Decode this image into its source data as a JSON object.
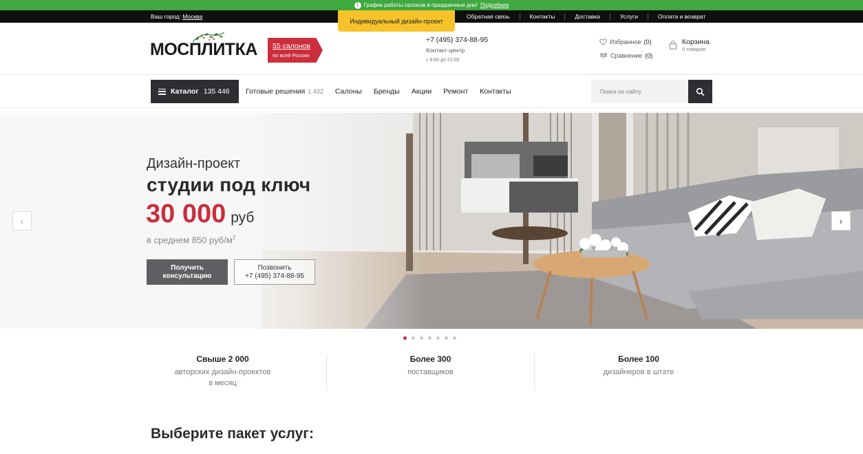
{
  "notice": {
    "text": "График работы салонов в праздничные дни!",
    "link": "Подробнее"
  },
  "topbar": {
    "city_label": "Ваш город:",
    "city": "Москва",
    "design_tab": "Индивидуальный дизайн-проект",
    "links": [
      "Обратная связь",
      "Контакты",
      "Доставка",
      "Услуги",
      "Оплата и возврат"
    ]
  },
  "header": {
    "logo": "МОСПЛИТКА",
    "salons_count": "55 салонов",
    "salons_sub": "по всей России",
    "phone": "+7 (495) 374-88-95",
    "contact_center": "Контакт-центр",
    "hours": "с 9:00 до 21:00",
    "favorites_label": "Избранное",
    "favorites_count": "(0)",
    "compare_label": "Сравнение",
    "compare_count": "(0)",
    "cart_label": "Корзина",
    "cart_sub": "0 товаров"
  },
  "nav": {
    "catalog_label": "Каталог",
    "catalog_count": "135 446",
    "items": [
      {
        "label": "Готовые решения",
        "count": "1 432"
      },
      {
        "label": "Салоны"
      },
      {
        "label": "Бренды"
      },
      {
        "label": "Акции"
      },
      {
        "label": "Ремонт"
      },
      {
        "label": "Контакты"
      }
    ],
    "search_placeholder": "Поиск по сайту"
  },
  "hero": {
    "subtitle": "Дизайн-проект",
    "title": "студии под ключ",
    "price": "30 000",
    "currency": "руб",
    "avg": "в среднем 850 руб/м",
    "avg_sup": "2",
    "consult_button": "Получить консультацию",
    "call_button_line1": "Позвонить",
    "call_button_line2": "+7 (495) 374-88-95",
    "slides_total": 7,
    "active_slide": 1
  },
  "stats": [
    {
      "title": "Свыше 2 000",
      "desc": "авторских дизайн-проектов\nв месяц"
    },
    {
      "title": "Более 300",
      "desc": "поставщиков"
    },
    {
      "title": "Более 100",
      "desc": "дизайнеров в штате"
    }
  ],
  "section_title": "Выберите пакет услуг:",
  "colors": {
    "accent_red": "#c8303d",
    "notice_green": "#3fa83f",
    "dark": "#2d2f33",
    "yellow_tab": "#f6c32b"
  }
}
